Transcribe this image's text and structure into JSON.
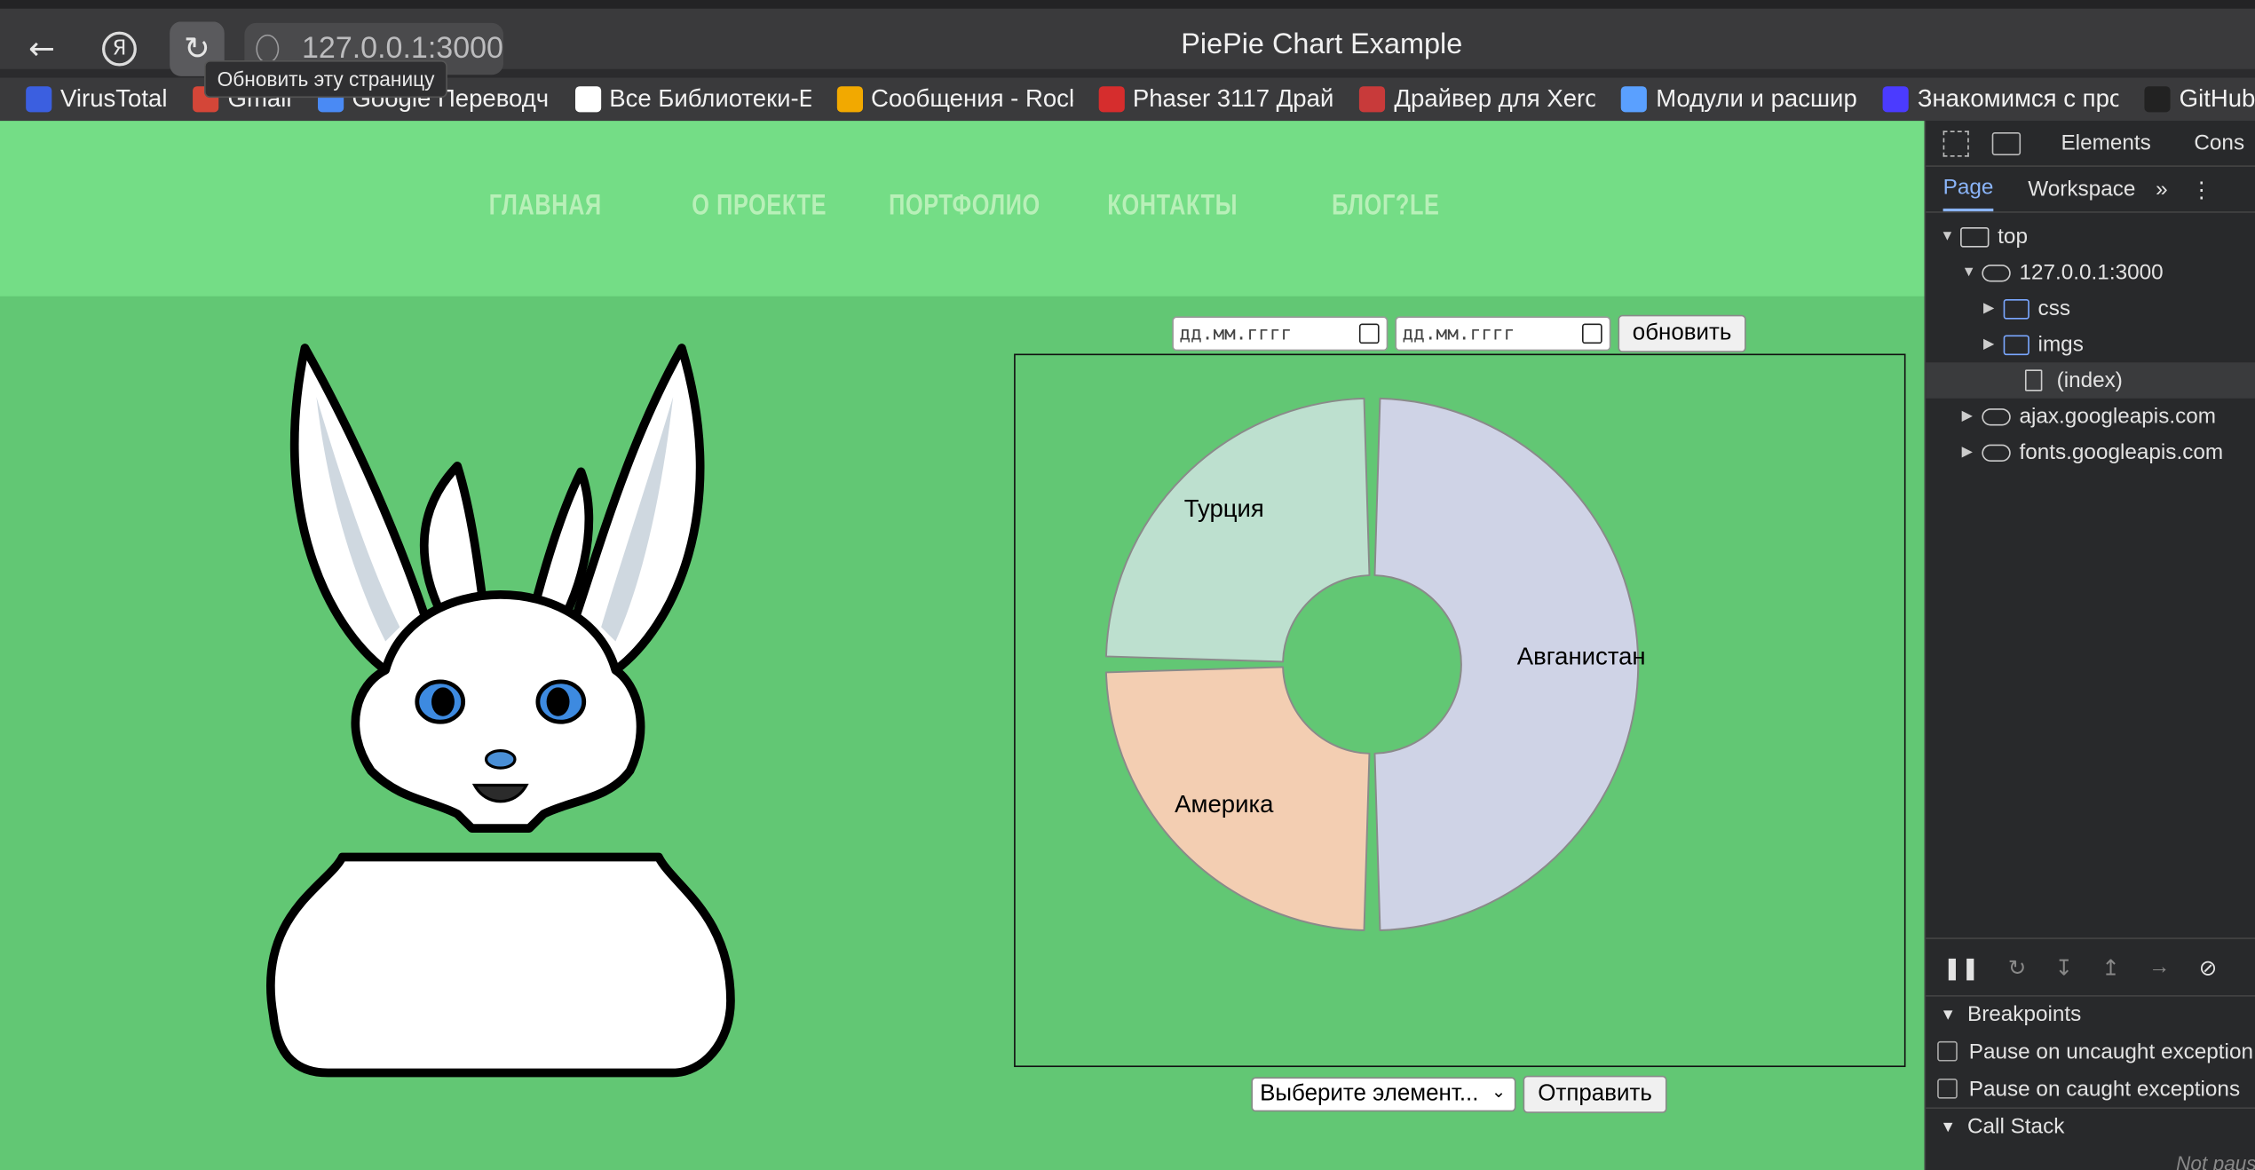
{
  "browser": {
    "window_title": "PiePie Chart Example",
    "url": "127.0.0.1:3000",
    "reload_tooltip": "Обновить эту страницу",
    "bookmarks": [
      {
        "label": "VirusTotal",
        "icon": "virustotal-icon",
        "color": "#3b5fe0"
      },
      {
        "label": "Gmail",
        "icon": "gmail-icon",
        "color": "#d44638"
      },
      {
        "label": "Google Переводч",
        "icon": "translate-icon",
        "color": "#4a8af4"
      },
      {
        "label": "Все Библиотеки-E",
        "icon": "library-icon",
        "color": "#ffffff"
      },
      {
        "label": "Сообщения - Rock",
        "icon": "rockstar-icon",
        "color": "#f2a900"
      },
      {
        "label": "Phaser 3117 Драй",
        "icon": "xerox-icon",
        "color": "#d62d2d"
      },
      {
        "label": "Драйвер для Xero",
        "icon": "driver-icon",
        "color": "#c83a3a"
      },
      {
        "label": "Модули и расшир",
        "icon": "modules-icon",
        "color": "#5aa0ff"
      },
      {
        "label": "Знакомимся с про",
        "icon": "s-icon",
        "color": "#4b3bff"
      },
      {
        "label": "GitHub - thiagoa",
        "icon": "github-icon",
        "color": "#222222"
      }
    ]
  },
  "page": {
    "nav": [
      "ГЛАВНАЯ",
      "О ПРОЕКТЕ",
      "ПОРТФОЛИО",
      "КОНТАКТЫ",
      "БЛОГ?LE"
    ],
    "date_from_placeholder": "дд.мм.гггг",
    "date_to_placeholder": "дд.мм.гггг",
    "refresh_button": "обновить",
    "select_value": "Выберите элемент...",
    "submit_button": "Отправить",
    "colors": {
      "header_bg": "#74dd86",
      "page_bg": "#62c774"
    }
  },
  "chart_data": {
    "type": "pie",
    "donut": true,
    "categories": [
      "Авганистан",
      "Америка",
      "Турция"
    ],
    "values": [
      50,
      25,
      25
    ],
    "colors": [
      "#cfd3e6",
      "#f3ceb2",
      "#bde0cf"
    ],
    "title": ""
  },
  "devtools": {
    "tabs": [
      "Elements",
      "Cons"
    ],
    "subtabs": [
      "Page",
      "Workspace"
    ],
    "tree": [
      {
        "label": "top",
        "indent": 0,
        "kind": "frame",
        "open": true
      },
      {
        "label": "127.0.0.1:3000",
        "indent": 1,
        "kind": "cloud",
        "open": true
      },
      {
        "label": "css",
        "indent": 2,
        "kind": "folder",
        "open": false
      },
      {
        "label": "imgs",
        "indent": 2,
        "kind": "folder",
        "open": false
      },
      {
        "label": "(index)",
        "indent": 3,
        "kind": "file",
        "selected": true
      },
      {
        "label": "ajax.googleapis.com",
        "indent": 1,
        "kind": "cloud",
        "open": false
      },
      {
        "label": "fonts.googleapis.com",
        "indent": 1,
        "kind": "cloud",
        "open": false
      }
    ],
    "breakpoints_title": "Breakpoints",
    "pause_uncaught": "Pause on uncaught exception",
    "pause_caught": "Pause on caught exceptions",
    "call_stack_title": "Call Stack",
    "not_paused": "Not paus"
  }
}
